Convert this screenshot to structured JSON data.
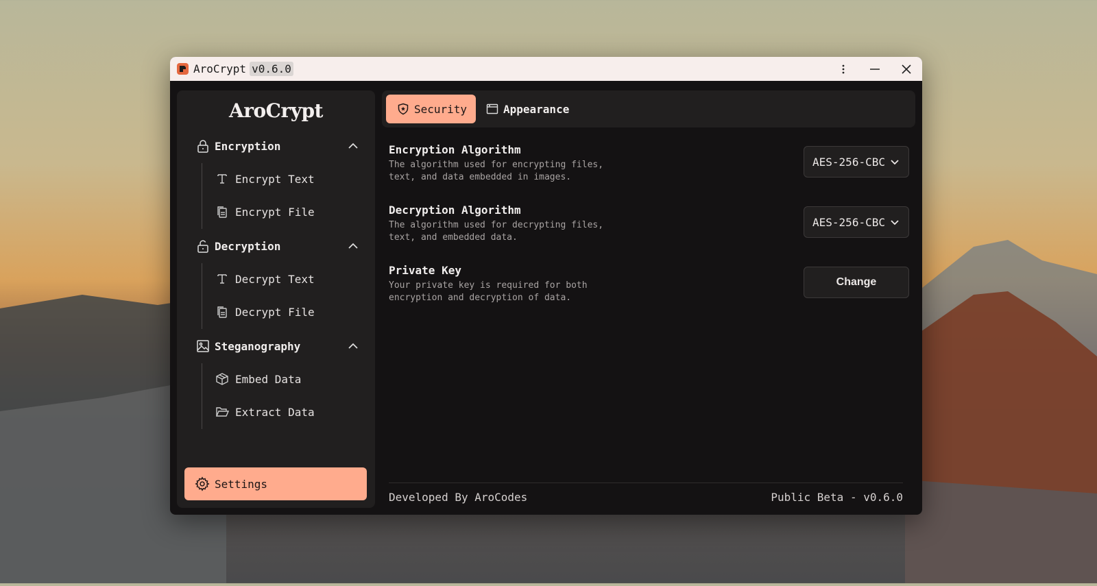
{
  "window": {
    "title": "AroCrypt",
    "version": "v0.6.0"
  },
  "sidebar": {
    "brand": "AroCrypt",
    "sections": [
      {
        "label": "Encryption",
        "icon": "lock-icon",
        "items": [
          {
            "label": "Encrypt Text",
            "icon": "text-icon"
          },
          {
            "label": "Encrypt File",
            "icon": "file-icon"
          }
        ]
      },
      {
        "label": "Decryption",
        "icon": "unlock-icon",
        "items": [
          {
            "label": "Decrypt Text",
            "icon": "text-icon"
          },
          {
            "label": "Decrypt File",
            "icon": "file-icon"
          }
        ]
      },
      {
        "label": "Steganography",
        "icon": "image-icon",
        "items": [
          {
            "label": "Embed Data",
            "icon": "box-icon"
          },
          {
            "label": "Extract Data",
            "icon": "folder-open-icon"
          }
        ]
      }
    ],
    "settings_label": "Settings"
  },
  "tabs": [
    {
      "label": "Security",
      "icon": "shield-icon",
      "active": true
    },
    {
      "label": "Appearance",
      "icon": "window-icon",
      "active": false
    }
  ],
  "settings": {
    "encryption": {
      "title": "Encryption Algorithm",
      "desc": "The algorithm used for encrypting files, text, and data embedded in images.",
      "value": "AES-256-CBC"
    },
    "decryption": {
      "title": "Decryption Algorithm",
      "desc": "The algorithm used for decrypting files, text, and embedded data.",
      "value": "AES-256-CBC"
    },
    "private_key": {
      "title": "Private Key",
      "desc": "Your private key is required for both encryption and decryption of data.",
      "button": "Change"
    }
  },
  "footer": {
    "left": "Developed By AroCodes",
    "right": "Public Beta - v0.6.0"
  },
  "colors": {
    "accent": "#ffab8d",
    "panel": "#211f1f",
    "window_bg": "#141213",
    "titlebar": "#f7eeec"
  }
}
